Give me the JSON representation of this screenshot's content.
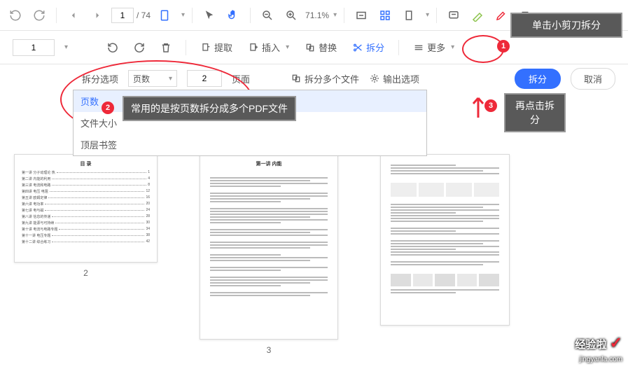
{
  "top": {
    "page_current": "1",
    "page_total": "/ 74",
    "zoom": "71.1%"
  },
  "second": {
    "page_field": "1",
    "extract": "提取",
    "insert": "插入",
    "replace": "替换",
    "split": "拆分",
    "more": "更多"
  },
  "splitbar": {
    "options_label": "拆分选项",
    "select_value": "页数",
    "num_value": "2",
    "page_label": "页面",
    "multi": "拆分多个文件",
    "output": "输出选项",
    "btn_split": "拆分",
    "btn_cancel": "取消"
  },
  "dropdown": {
    "item1": "页数",
    "item2": "文件大小",
    "item3": "顶层书签"
  },
  "anno": {
    "a1": "单击小剪刀拆分",
    "a2": "常用的是按页数拆分成多个PDF文件",
    "a3": "再点击拆分",
    "b1": "1",
    "b2": "2",
    "b3": "3"
  },
  "thumbs": {
    "p2_title": "目 录",
    "p3_title": "第一讲 内能",
    "cap2": "2",
    "cap3": "3"
  },
  "watermark": {
    "brand": "经验啦",
    "url": "jingyanla.com"
  }
}
